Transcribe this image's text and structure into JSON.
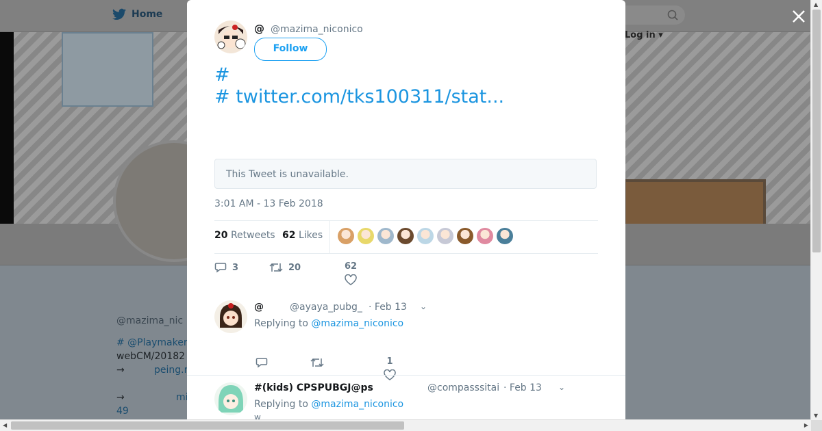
{
  "nav": {
    "home_label": "Home",
    "login_label": "Log in"
  },
  "background_profile": {
    "name": "",
    "handle": "@mazima_nic",
    "bio_hashtag": "# @Playmaker",
    "bio_line2": "webCM/20182",
    "bio_arrow1": "→",
    "bio_link1": "peing.n",
    "bio_arrow2": "→",
    "bio_link2": "mi",
    "bio_count": "49"
  },
  "modal": {
    "close_label": "✕",
    "author": {
      "name": "@",
      "handle": "@mazima_niconico",
      "follow_label": "Follow"
    },
    "tweet": {
      "line1": "",
      "line2": "",
      "hashtag1": "#",
      "after_hashtag1": " ",
      "hashtag2": "#",
      "link": "twitter.com/tks100311/stat..."
    },
    "quoted": "This Tweet is unavailable.",
    "timestamp": "3:01 AM - 13 Feb 2018",
    "stats": {
      "retweets_count": "20",
      "retweets_label": "Retweets",
      "likes_count": "62",
      "likes_label": "Likes"
    },
    "likers": [
      {
        "color": "#d9a066"
      },
      {
        "color": "#e8d86a"
      },
      {
        "color": "#9fb8cc"
      },
      {
        "color": "#6b4a2e"
      },
      {
        "color": "#bcd7e6"
      },
      {
        "color": "#c7c9d6"
      },
      {
        "color": "#8a5a2b"
      },
      {
        "color": "#e08aa0"
      },
      {
        "color": "#4a7f9a"
      }
    ],
    "actions": {
      "replies": "3",
      "retweets": "20",
      "likes": "62"
    },
    "replies": [
      {
        "name": "@",
        "handle": "@ayaya_pubg_",
        "date": "· Feb 13",
        "replying_prefix": "Replying to",
        "replying_to": "@mazima_niconico",
        "likes": "1"
      },
      {
        "name": "#(kids) CPSPUBGJ@ps",
        "handle": "@compasssitai",
        "date": "· Feb 13",
        "replying_prefix": "Replying to",
        "replying_to": "@mazima_niconico",
        "trailing": "w"
      }
    ]
  }
}
